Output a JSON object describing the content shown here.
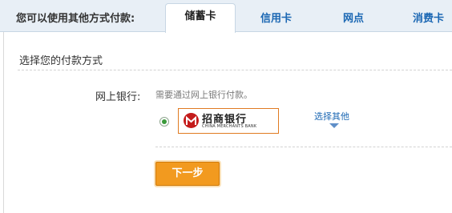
{
  "tabbar": {
    "label": "您可以使用其他方式付款:",
    "tabs": [
      {
        "label": "储蓄卡",
        "active": true
      },
      {
        "label": "信用卡",
        "active": false
      },
      {
        "label": "网点",
        "active": false
      },
      {
        "label": "消费卡",
        "active": false
      }
    ]
  },
  "section": {
    "title": "选择您的付款方式"
  },
  "online_bank": {
    "label": "网上银行:",
    "hint": "需要通过网上银行付款。",
    "selected": true,
    "bank": {
      "name_cn": "招商银行",
      "name_en": "CHINA MERCHANTS BANK",
      "logo_color": "#c41b1b"
    },
    "choose_other_label": "选择其他"
  },
  "next_button": {
    "label": "下一步",
    "color": "#f29a1f"
  }
}
